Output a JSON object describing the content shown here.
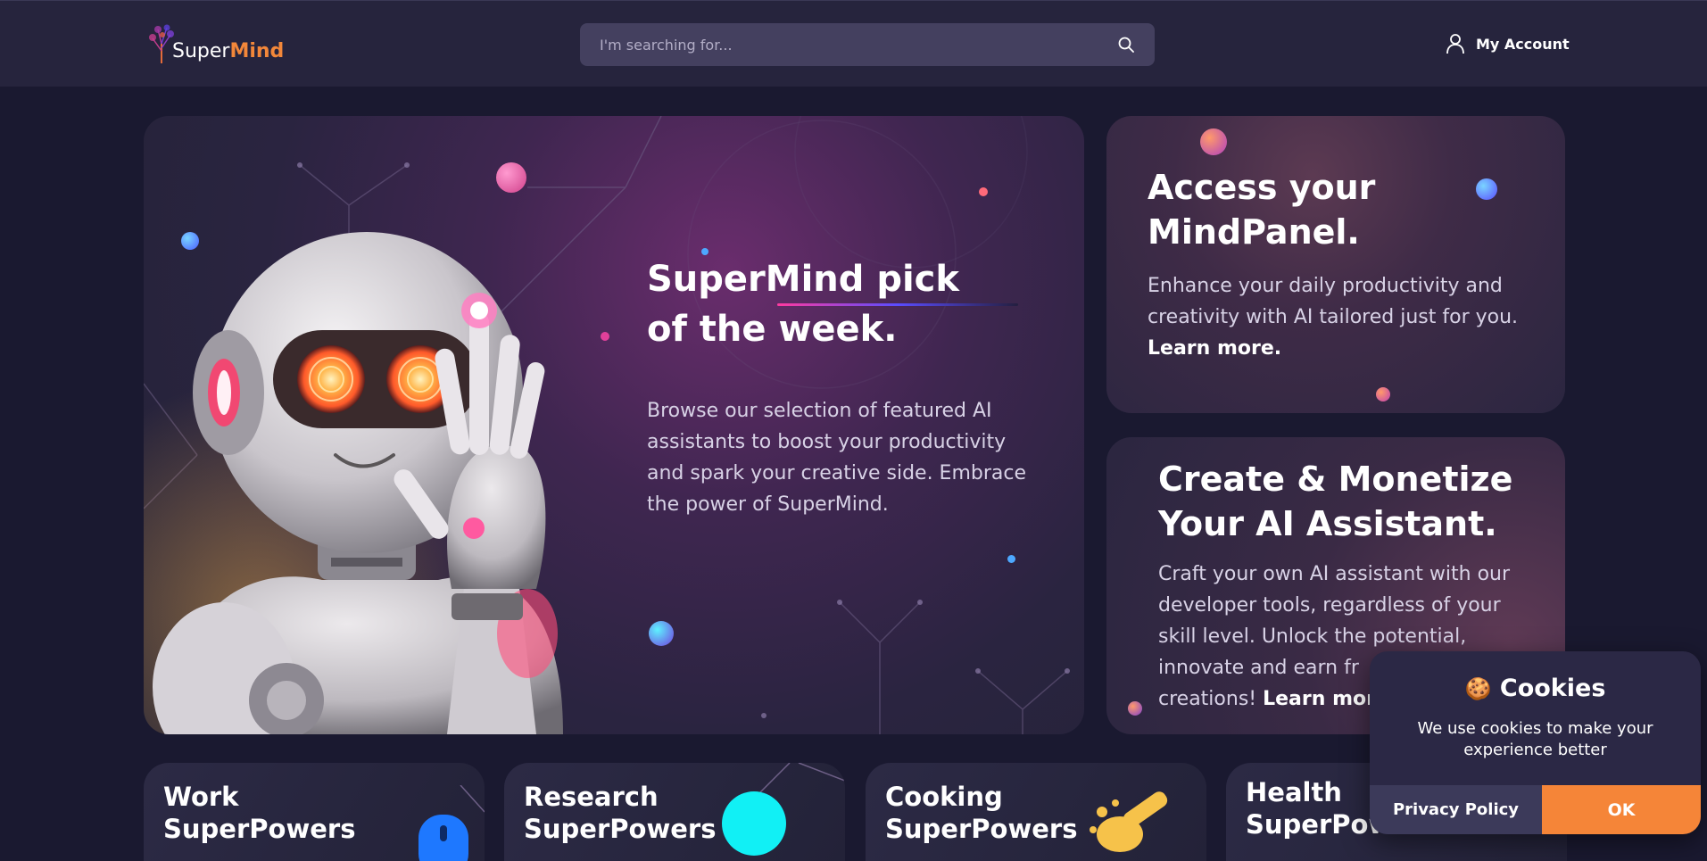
{
  "brand": {
    "name_part1": "Super",
    "name_part2": "Mind",
    "accent": "#f2873a"
  },
  "search": {
    "placeholder": "I'm searching for...",
    "icon": "search-icon"
  },
  "account": {
    "label": "My Account",
    "icon": "user-icon"
  },
  "hero": {
    "title_line1": "SuperMind pick",
    "title_line2": "of the week.",
    "description": "Browse our selection of featured AI assistants to boost your productivity and spark your creative side. Embrace the power of SuperMind."
  },
  "cards": [
    {
      "title_line1": "Access your",
      "title_line2": "MindPanel.",
      "description": "Enhance your daily productivity and creativity with AI tailored just for you.",
      "link": "Learn more."
    },
    {
      "title_line1": "Create & Monetize",
      "title_line2": "Your AI Assistant.",
      "description": "Craft your own AI assistant with our developer tools, regardless of your skill level. Unlock the potential, innovate and earn fr",
      "desc_end": "creations!",
      "link": "Learn mor"
    }
  ],
  "categories": [
    {
      "title_line1": "Work",
      "title_line2": "SuperPowers"
    },
    {
      "title_line1": "Research",
      "title_line2": "SuperPowers"
    },
    {
      "title_line1": "Cooking",
      "title_line2": "SuperPowers"
    },
    {
      "title_line1": "Health",
      "title_line2": "SuperPow"
    }
  ],
  "cookie": {
    "icon": "cookie-icon",
    "title": "Cookies",
    "body": "We use cookies to make your experience better",
    "privacy_label": "Privacy Policy",
    "ok_label": "OK"
  },
  "colors": {
    "background": "#1a1930",
    "header": "#26243d",
    "ok_button": "#f58538",
    "underline_start": "#ff3aa0",
    "underline_end": "#5a4cff"
  }
}
